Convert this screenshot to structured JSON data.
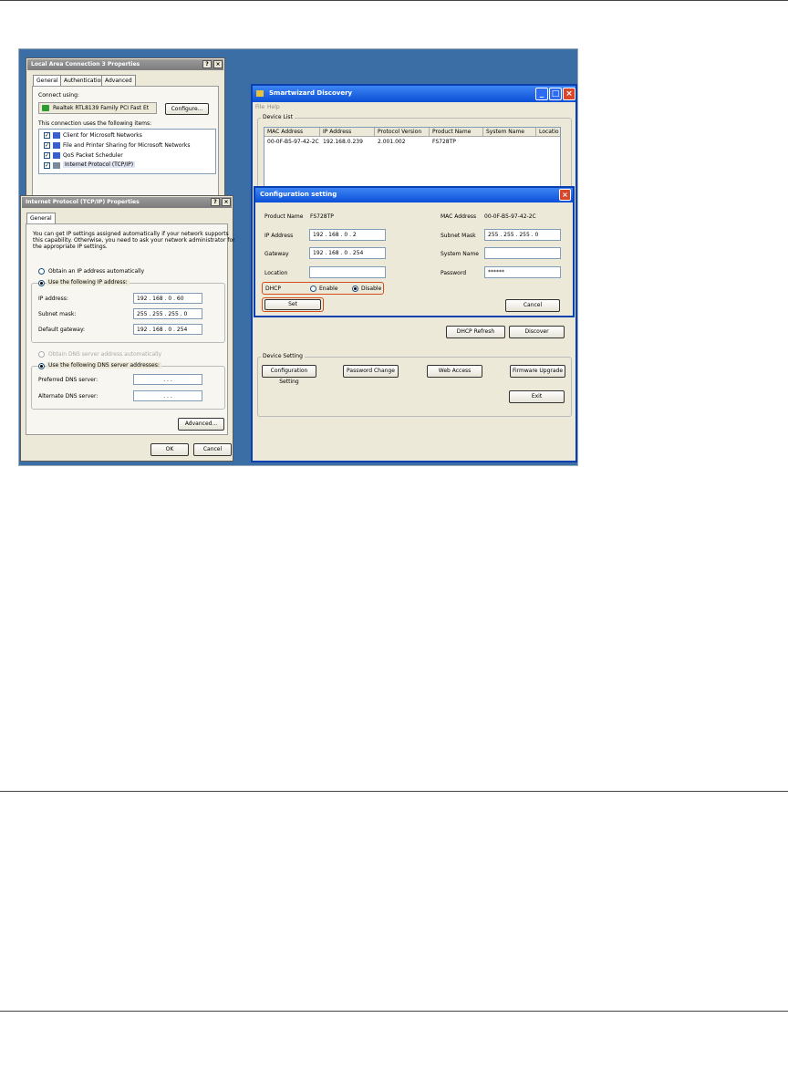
{
  "lan_dialog": {
    "title": "Local Area Connection 3 Properties",
    "help_btn": "?",
    "close_btn": "×",
    "tabs": [
      "General",
      "Authentication",
      "Advanced"
    ],
    "connect_using_label": "Connect using:",
    "adapter": "Realtek RTL8139 Family PCI Fast Et",
    "configure_btn": "Configure...",
    "items_label": "This connection uses the following items:",
    "items": [
      "Client for Microsoft Networks",
      "File and Printer Sharing for Microsoft Networks",
      "QoS Packet Scheduler",
      "Internet Protocol (TCP/IP)"
    ],
    "check_mark": "✓"
  },
  "tcpip_dialog": {
    "title": "Internet Protocol (TCP/IP) Properties",
    "help_btn": "?",
    "close_btn": "×",
    "tab": "General",
    "intro": [
      "You can get IP settings assigned automatically if your network supports",
      "this capability. Otherwise, you need to ask your network administrator for",
      "the appropriate IP settings."
    ],
    "obtain_auto": "Obtain an IP address automatically",
    "use_following": "Use the following IP address:",
    "ip_label": "IP address:",
    "ip_value": "192 . 168 . 0 . 60",
    "mask_label": "Subnet mask:",
    "mask_value": "255 . 255 . 255 . 0",
    "gateway_label": "Default gateway:",
    "gateway_value": "192 . 168 . 0 . 254",
    "dns_auto": "Obtain DNS server address automatically",
    "dns_use": "Use the following DNS server addresses:",
    "pref_dns_label": "Preferred DNS server:",
    "alt_dns_label": "Alternate DNS server:",
    "dns_blank": ".     .     .",
    "advanced_btn": "Advanced...",
    "ok_btn": "OK",
    "cancel_btn": "Cancel"
  },
  "smartwizard": {
    "title": "Smartwizard Discovery",
    "menu": [
      "File",
      "Help"
    ],
    "min_btn": "_",
    "max_btn": "□",
    "close_btn": "×",
    "device_list_label": "Device List",
    "columns": [
      "MAC Address",
      "IP Address",
      "Protocol Version",
      "Product Name",
      "System Name",
      "Locatio"
    ],
    "rows": [
      [
        "00-0F-B5-97-42-2C",
        "192.168.0.239",
        "2.001.002",
        "FS728TP",
        "",
        ""
      ]
    ],
    "dhcp_refresh_btn": "DHCP Refresh",
    "discover_btn": "Discover",
    "device_setting_label": "Device Setting",
    "config_btn": "Configuration Setting",
    "password_btn": "Password Change",
    "web_btn": "Web Access",
    "firmware_btn": "Firmware Upgrade",
    "exit_btn": "Exit"
  },
  "config_dialog": {
    "title": "Configuration setting",
    "close_btn": "×",
    "product_name_label": "Product Name",
    "product_name_value": "FS728TP",
    "mac_label": "MAC Address",
    "mac_value": "00-0F-B5-97-42-2C",
    "ip_label": "IP Address",
    "ip_value": "192 . 168 . 0 . 2",
    "subnet_label": "Subnet Mask",
    "subnet_value": "255 . 255 . 255 . 0",
    "gateway_label": "Gateway",
    "gateway_value": "192 . 168 . 0 . 254",
    "system_name_label": "System Name",
    "location_label": "Location",
    "password_label": "Password",
    "password_value": "******",
    "dhcp_label": "DHCP",
    "enable_label": "Enable",
    "disable_label": "Disable",
    "set_btn": "Set",
    "cancel_btn": "Cancel"
  },
  "colors": {
    "desktop": "#3a6ea5",
    "highlight": "#d54b1c",
    "xp_title": "#0a4fd6"
  }
}
